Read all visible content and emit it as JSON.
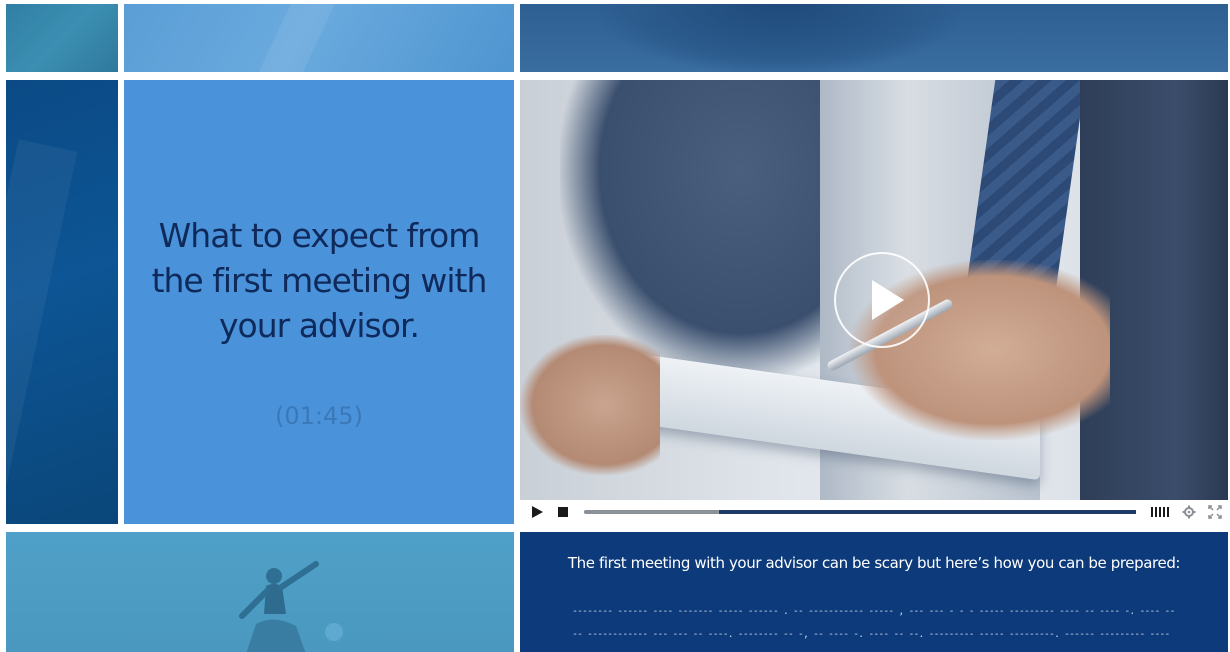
{
  "hero": {
    "headline": "What to expect from the first meeting with your advisor.",
    "duration": "(01:45)"
  },
  "video": {
    "play_icon": "play-icon",
    "controls": {
      "play_icon": "play-icon",
      "stop_icon": "stop-icon",
      "volume_icon": "volume-bars-icon",
      "settings_icon": "gear-icon",
      "fullscreen_icon": "fullscreen-icon",
      "progress": 0.245
    }
  },
  "caption": {
    "text": "The first meeting with your advisor can be scary but here’s how you can be prepared:",
    "placeholder_line_1": "-------- ------ ---- ------- ----- ------ . -- ----------- ----- , --- --- - - - ----- --------- ---- -- ---- -. ---- ---- -----",
    "placeholder_line_2": "-- ------------ --- --- -- ----.  -------- -- -, -- ---- -. ---- -- --. --------- ----- ---------. ------ --------- ---- --- . ---"
  },
  "colors": {
    "accent_light": "#4a93db",
    "accent_dark": "#0c3a7a",
    "headline": "#0f2a5a"
  }
}
